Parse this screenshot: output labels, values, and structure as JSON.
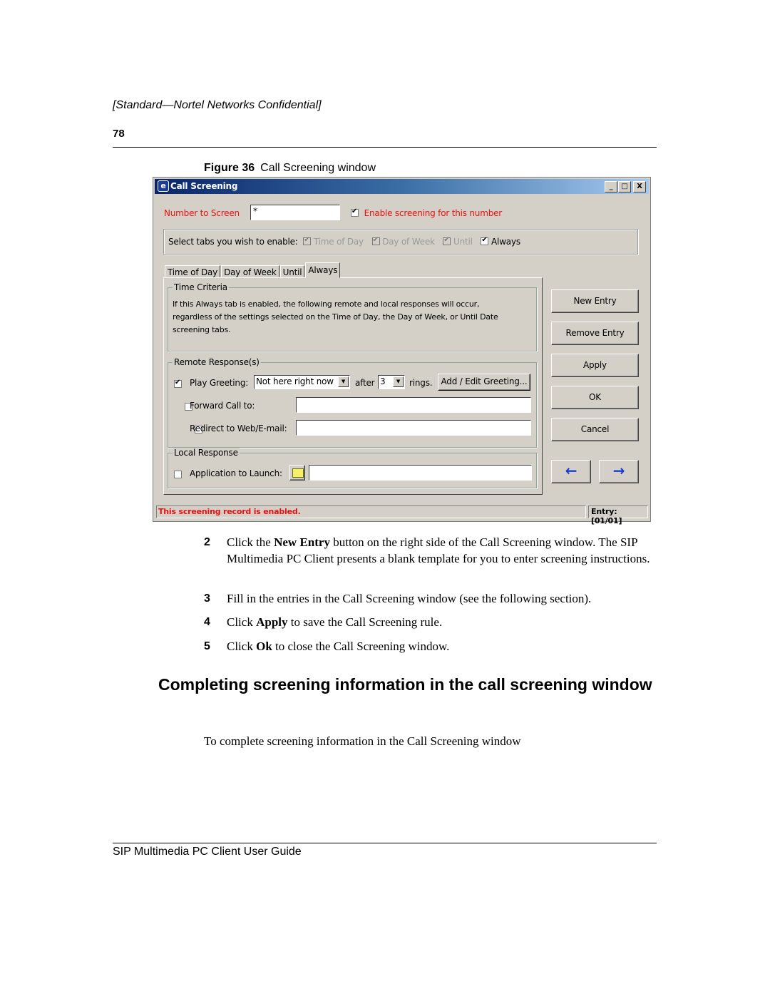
{
  "header": {
    "confidential": "[Standard—Nortel Networks Confidential]",
    "page_number": "78"
  },
  "figure": {
    "label": "Figure 36",
    "caption": "Call Screening window"
  },
  "window": {
    "title": "Call Screening",
    "title_buttons": {
      "minimize": "_",
      "maximize": "□",
      "close": "X"
    },
    "number_label": "Number to Screen",
    "number_value": "*",
    "enable_label": "Enable screening for this number",
    "enable_checked": true,
    "tabs_prompt": "Select tabs you wish to enable:",
    "tab_checks": [
      {
        "label": "Time of Day",
        "checked": true,
        "disabled": true
      },
      {
        "label": "Day of Week",
        "checked": true,
        "disabled": true
      },
      {
        "label": "Until",
        "checked": true,
        "disabled": true
      },
      {
        "label": "Always",
        "checked": true,
        "disabled": false
      }
    ],
    "tabs": [
      "Time of Day",
      "Day of Week",
      "Until",
      "Always"
    ],
    "active_tab": "Always",
    "time_criteria": {
      "legend": "Time Criteria",
      "text": "If this Always tab is enabled, the following remote and local responses will occur, regardless of the settings selected on the Time of Day, the Day of Week, or Until Date screening tabs."
    },
    "remote": {
      "legend": "Remote Response(s)",
      "play_greeting_label": "Play Greeting:",
      "play_greeting_checked": true,
      "greeting_value": "Not here right now",
      "after_label": "after",
      "rings_value": "3",
      "rings_label": "rings.",
      "add_edit_label": "Add / Edit Greeting...",
      "forward_label": "Forward Call to:",
      "forward_checked": false,
      "forward_value": "",
      "redirect_label": "Redirect to Web/E-mail:",
      "redirect_checked": false,
      "redirect_value": ""
    },
    "local": {
      "legend": "Local Response",
      "app_label": "Application to Launch:",
      "app_checked": false,
      "app_value": ""
    },
    "buttons": {
      "new_entry": "New Entry",
      "remove_entry": "Remove Entry",
      "apply": "Apply",
      "ok": "OK",
      "cancel": "Cancel",
      "prev": "🡸",
      "next": "🡺"
    },
    "status": {
      "message": "This screening record is enabled.",
      "entry": "Entry: [01/01]"
    }
  },
  "steps": [
    {
      "num": "2",
      "pre": "Click the ",
      "bold": "New Entry",
      "post": " button on the right side of the Call Screening window. The SIP Multimedia PC Client presents a blank template for you to enter screening instructions."
    },
    {
      "num": "3",
      "pre": "Fill in the entries in the Call Screening window (see the following section).",
      "bold": "",
      "post": ""
    },
    {
      "num": "4",
      "pre": "Click ",
      "bold": "Apply",
      "post": " to save the Call Screening rule."
    },
    {
      "num": "5",
      "pre": "Click ",
      "bold": "Ok",
      "post": " to close the Call Screening window."
    }
  ],
  "section": {
    "title": "Completing screening information in the call screening window",
    "intro": "To complete screening information in the Call Screening window"
  },
  "footer": {
    "text": "SIP Multimedia PC Client User Guide"
  }
}
